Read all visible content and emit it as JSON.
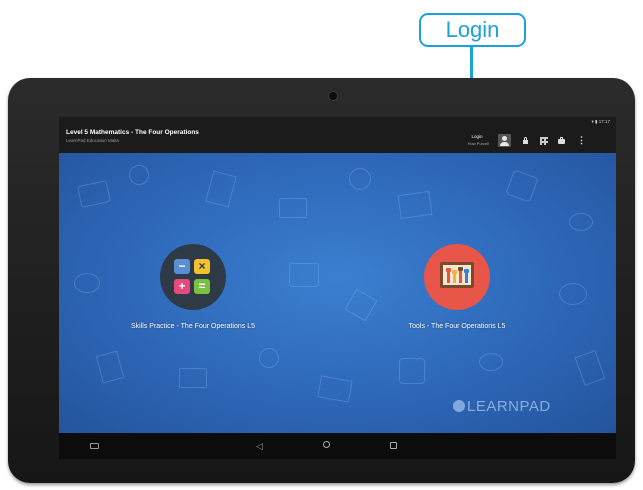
{
  "callout": {
    "label": "Login"
  },
  "app_bar": {
    "title": "Level 5 Mathematics - The Four Operations",
    "subtitle": "LearnPad Education Malta",
    "status_time": "17:17",
    "login_label": "Login",
    "login_user": "Huw Purcell"
  },
  "apps": [
    {
      "label": "Skills Practice - The Four Operations L5",
      "icon": "calculator-tiles-icon"
    },
    {
      "label": "Tools - The Four Operations L5",
      "icon": "tools-board-icon"
    }
  ],
  "brand": {
    "name": "LEARNPAD"
  },
  "navbar": {
    "back": "◁"
  },
  "colors": {
    "callout": "#1aa3d9",
    "background_blue": "#2e67b8",
    "tools_circle": "#e8564a",
    "skills_circle": "#2e3a46"
  }
}
